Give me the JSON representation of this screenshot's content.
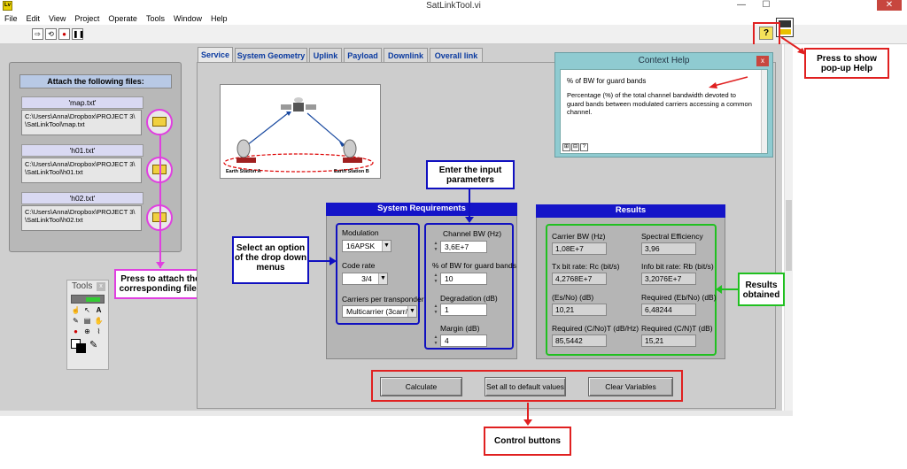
{
  "window": {
    "title": "SatLinkTool.vi",
    "minimize": "—",
    "maximize": "☐",
    "close": "✕"
  },
  "menu": [
    "File",
    "Edit",
    "View",
    "Project",
    "Operate",
    "Tools",
    "Window",
    "Help"
  ],
  "toolbar": {
    "run_icon": "run-arrow-icon",
    "run_cont_icon": "run-continuously-icon",
    "abort_icon": "abort-icon",
    "pause_icon": "pause-icon",
    "help_icon": "?"
  },
  "attach": {
    "title": "Attach the following files:",
    "files": [
      {
        "label": "'map.txt'",
        "path": "C:\\Users\\Anna\\Dropbox\\PROJECT 3\\\n\\SatLinkTool\\map.txt"
      },
      {
        "label": "'h01.txt'",
        "path": "C:\\Users\\Anna\\Dropbox\\PROJECT 3\\\n\\SatLinkTool\\h01.txt"
      },
      {
        "label": "'h02.txt'",
        "path": "C:\\Users\\Anna\\Dropbox\\PROJECT 3\\\n\\SatLinkTool\\h02.txt"
      }
    ]
  },
  "tabs": [
    "Service",
    "System Geometry",
    "Uplink",
    "Payload",
    "Downlink",
    "Overall link"
  ],
  "diagram": {
    "station_a": "Earth Station A",
    "station_b": "Earth Station B"
  },
  "requirements": {
    "title": "System Requirements",
    "modulation_label": "Modulation",
    "modulation_value": "16APSK",
    "coderate_label": "Code rate",
    "coderate_value": "3/4",
    "carriers_label": "Carriers per transponder",
    "carriers_value": "Multicarrier (3carr/",
    "channel_bw_label": "Channel BW (Hz)",
    "channel_bw_value": "3,6E+7",
    "guard_label": "% of BW for guard bands",
    "guard_value": "10",
    "degradation_label": "Degradation (dB)",
    "degradation_value": "1",
    "margin_label": "Margin (dB)",
    "margin_value": "4"
  },
  "results": {
    "title": "Results",
    "items": [
      {
        "label": "Carrier BW (Hz)",
        "value": "1,08E+7"
      },
      {
        "label": "Spectral Efficiency",
        "value": "3,96"
      },
      {
        "label": "Tx bit rate: Rc (bit/s)",
        "value": "4,2768E+7"
      },
      {
        "label": "Info bit rate: Rb (bit/s)",
        "value": "3,2076E+7"
      },
      {
        "label": "(Es/No) (dB)",
        "value": "10,21"
      },
      {
        "label": "Required (Eb/No) (dB)",
        "value": "6,48244"
      },
      {
        "label": "Required (C/No)T (dB/Hz)",
        "value": "85,5442"
      },
      {
        "label": "Required (C/N)T (dB)",
        "value": "15,21"
      }
    ]
  },
  "buttons": {
    "calculate": "Calculate",
    "defaults": "Set all to default values",
    "clear": "Clear Variables"
  },
  "context_help": {
    "title": "Context Help",
    "close": "x",
    "heading": "% of BW for guard bands",
    "body": "Percentage (%) of the total channel bandwidth devoted to guard bands between modulated carriers accessing a common channel."
  },
  "tools_palette": {
    "title": "Tools",
    "close": "x"
  },
  "callouts": {
    "popup_help": "Press to show pop-up Help",
    "enter_params": "Enter the input parameters",
    "select_option": "Select an option of the drop down menus",
    "results_obtained": "Results obtained",
    "attach_files": "Press to attach the corresponding files",
    "control_buttons": "Control buttons"
  },
  "colors": {
    "callout_red": "#e02020",
    "callout_blue": "#1010c0",
    "callout_green": "#20c020",
    "callout_magenta": "#e040e0",
    "header_blue": "#1414c8",
    "help_teal": "#8fcbd1"
  }
}
